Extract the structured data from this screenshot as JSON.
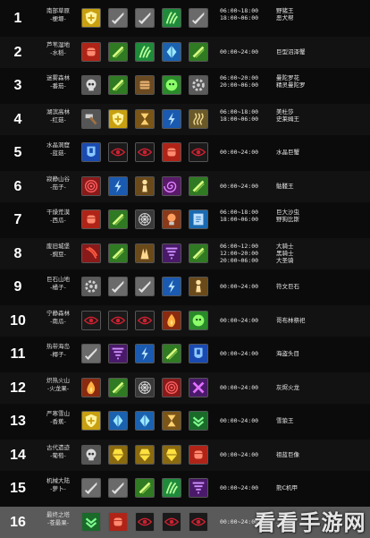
{
  "rows": [
    {
      "num": "1",
      "zone": [
        "南部草原",
        "-梗塬-"
      ],
      "icons": [
        "shield",
        "sword",
        "sword",
        "grass",
        "sword"
      ],
      "times": [
        "06:00~18:00",
        "18:00~06:00"
      ],
      "bosses": [
        "野猪王",
        "恶犬帮"
      ]
    },
    {
      "num": "2",
      "zone": [
        "芦苇湿地",
        "-水稻-"
      ],
      "icons": [
        "fist",
        "slash",
        "grass",
        "crystal",
        "slash"
      ],
      "times": [
        "00:00~24:00"
      ],
      "bosses": [
        "巨型沼泽蟹"
      ]
    },
    {
      "num": "3",
      "zone": [
        "迷雾森林",
        "-番茄-"
      ],
      "icons": [
        "skull",
        "slash",
        "drum",
        "face",
        "gear"
      ],
      "times": [
        "06:00~20:00",
        "20:00~06:00"
      ],
      "bosses": [
        "曼陀罗花",
        "精灵曼陀罗"
      ]
    },
    {
      "num": "4",
      "zone": [
        "湖滨高林",
        "-红菇-"
      ],
      "icons": [
        "hammer",
        "shield",
        "hourglass",
        "bolt",
        "wave"
      ],
      "times": [
        "06:00~18:00",
        "18:00~06:00"
      ],
      "bosses": [
        "美杜莎",
        "史莱姆王"
      ]
    },
    {
      "num": "5",
      "zone": [
        "水晶洞窟",
        "-蓝菇-"
      ],
      "icons": [
        "armor",
        "eye",
        "eye",
        "fist",
        "eye"
      ],
      "times": [
        "00:00~24:00"
      ],
      "bosses": [
        "水晶巨蟹"
      ]
    },
    {
      "num": "6",
      "zone": [
        "寂静山谷",
        "-茄子-"
      ],
      "icons": [
        "target",
        "bolt",
        "pawn",
        "spiral",
        "slash"
      ],
      "times": [
        "00:00~24:00"
      ],
      "bosses": [
        "骷髅王"
      ]
    },
    {
      "num": "7",
      "zone": [
        "干燥荒漠",
        "-西瓜-"
      ],
      "icons": [
        "fist",
        "slash",
        "web",
        "orb",
        "book"
      ],
      "times": [
        "06:00~18:00",
        "18:00~06:00"
      ],
      "bosses": [
        "巨大沙虫",
        "野狗比斯"
      ]
    },
    {
      "num": "8",
      "zone": [
        "废旧城堡",
        "-豌豆-"
      ],
      "icons": [
        "claw",
        "slash",
        "hands",
        "tornado",
        "slash"
      ],
      "times": [
        "06:00~12:00",
        "12:00~20:00",
        "20:00~06:00"
      ],
      "bosses": [
        "大骑士",
        "黑骑士",
        "大圣骑"
      ]
    },
    {
      "num": "9",
      "zone": [
        "巨石山地",
        "-橘子-"
      ],
      "icons": [
        "gear",
        "sword",
        "sword",
        "bolt",
        "pawn"
      ],
      "times": [
        "00:00~24:00"
      ],
      "bosses": [
        "符文巨石"
      ]
    },
    {
      "num": "10",
      "zone": [
        "宁静森林",
        "-南瓜-"
      ],
      "icons": [
        "eye",
        "eye",
        "eye",
        "flame",
        "face"
      ],
      "times": [
        "00:00~24:00"
      ],
      "bosses": [
        "哥布林祭祀"
      ]
    },
    {
      "num": "11",
      "zone": [
        "热带海岛",
        "-椰子-"
      ],
      "icons": [
        "sword",
        "tornado",
        "bolt",
        "slash",
        "armor"
      ],
      "times": [
        "00:00~24:00"
      ],
      "bosses": [
        "海盗头目"
      ]
    },
    {
      "num": "12",
      "zone": [
        "炽热火山",
        "-火龙果-"
      ],
      "icons": [
        "flame",
        "slash",
        "web",
        "target",
        "cross"
      ],
      "times": [
        "00:00~24:00"
      ],
      "bosses": [
        "灰烬火龙"
      ]
    },
    {
      "num": "13",
      "zone": [
        "严寒雪山",
        "-香蕉-"
      ],
      "icons": [
        "shield",
        "crystal",
        "crystal",
        "hourglass",
        "chevron"
      ],
      "times": [
        "00:00~24:00"
      ],
      "bosses": [
        "雪狼王"
      ]
    },
    {
      "num": "14",
      "zone": [
        "古代遗迹",
        "-葡萄-"
      ],
      "icons": [
        "skull",
        "gem",
        "gem",
        "gem",
        "fist"
      ],
      "times": [
        "00:00~24:00"
      ],
      "bosses": [
        "祖蓝巨像"
      ]
    },
    {
      "num": "15",
      "zone": [
        "机械大陆",
        "-萝卜-"
      ],
      "icons": [
        "sword",
        "sword",
        "slash",
        "grass",
        "tornado"
      ],
      "times": [
        "00:00~24:00"
      ],
      "bosses": [
        "熊C机甲"
      ]
    },
    {
      "num": "16",
      "zone": [
        "最终之塔",
        "-苍最果-"
      ],
      "icons": [
        "chevron",
        "fist",
        "eye",
        "eye",
        "eye"
      ],
      "times": [
        "00:00~24:00"
      ],
      "bosses": [
        "..."
      ]
    }
  ],
  "watermark": "看看手游网",
  "colors": {
    "background": "#0b0b0b",
    "text": "#e8e8e8",
    "last_row": "#5a5a5a"
  }
}
